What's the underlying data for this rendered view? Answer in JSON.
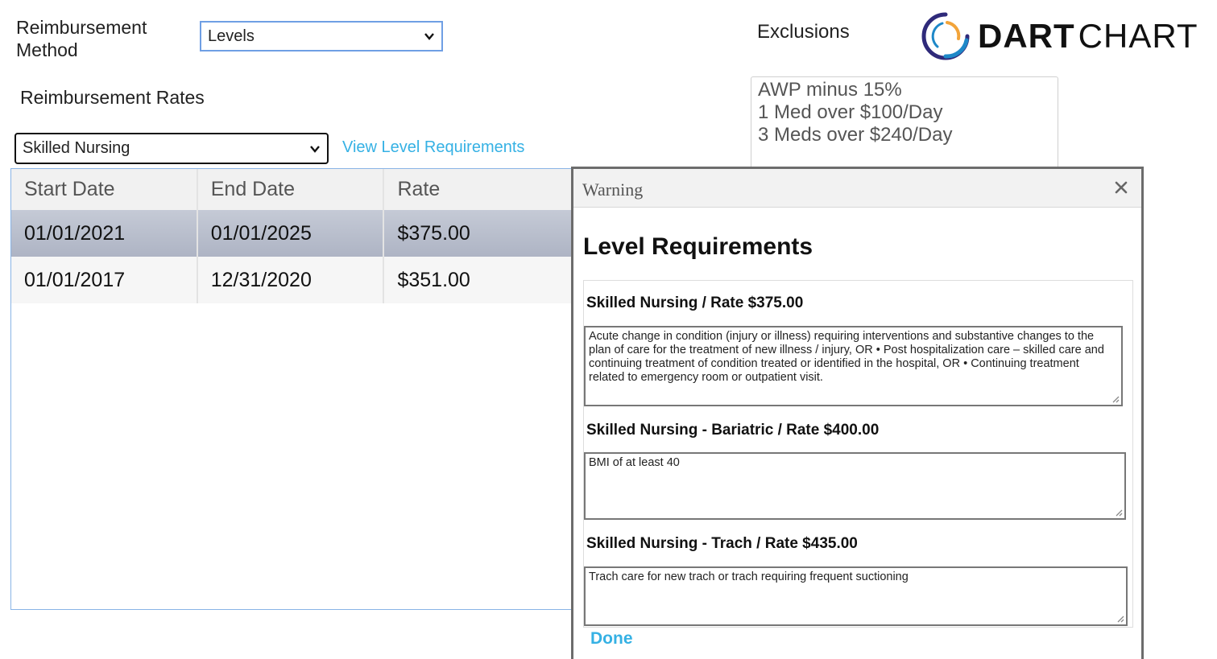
{
  "form": {
    "method_label": "Reimbursement Method",
    "method_value": "Levels",
    "rates_label": "Reimbursement Rates",
    "level_value": "Skilled Nursing",
    "view_link": "View Level Requirements"
  },
  "table": {
    "headers": [
      "Start Date",
      "End Date",
      "Rate"
    ],
    "rows": [
      [
        "01/01/2021",
        "01/01/2025",
        "$375.00"
      ],
      [
        "01/01/2017",
        "12/31/2020",
        "$351.00"
      ]
    ]
  },
  "exclusions": {
    "label": "Exclusions",
    "items": [
      "AWP minus 15%",
      "1 Med over $100/Day",
      "3 Meds over $240/Day"
    ]
  },
  "logo": {
    "word1": "DART",
    "word2": "CHART",
    "colors": [
      "#2f2a7a",
      "#1e88c8",
      "#f2a43a"
    ]
  },
  "modal": {
    "header": "Warning",
    "title": "Level Requirements",
    "requirements": [
      {
        "label": "Skilled Nursing / Rate $375.00",
        "text": "Acute change in condition (injury or illness) requiring interventions and substantive changes to the plan of care for the treatment of new illness / injury, OR • Post hospitalization care – skilled care and continuing treatment of condition treated or identified in the hospital, OR • Continuing treatment related to emergency room or outpatient visit."
      },
      {
        "label": "Skilled Nursing - Bariatric / Rate $400.00",
        "text": "BMI of at least 40"
      },
      {
        "label": "Skilled Nursing - Trach / Rate $435.00",
        "text": "Trach care for new trach or trach requiring frequent suctioning"
      }
    ],
    "done_label": "Done"
  },
  "colors": {
    "link": "#35b1e4",
    "selected_row": "#b6bccb",
    "focus_border": "#6f9fe4"
  }
}
